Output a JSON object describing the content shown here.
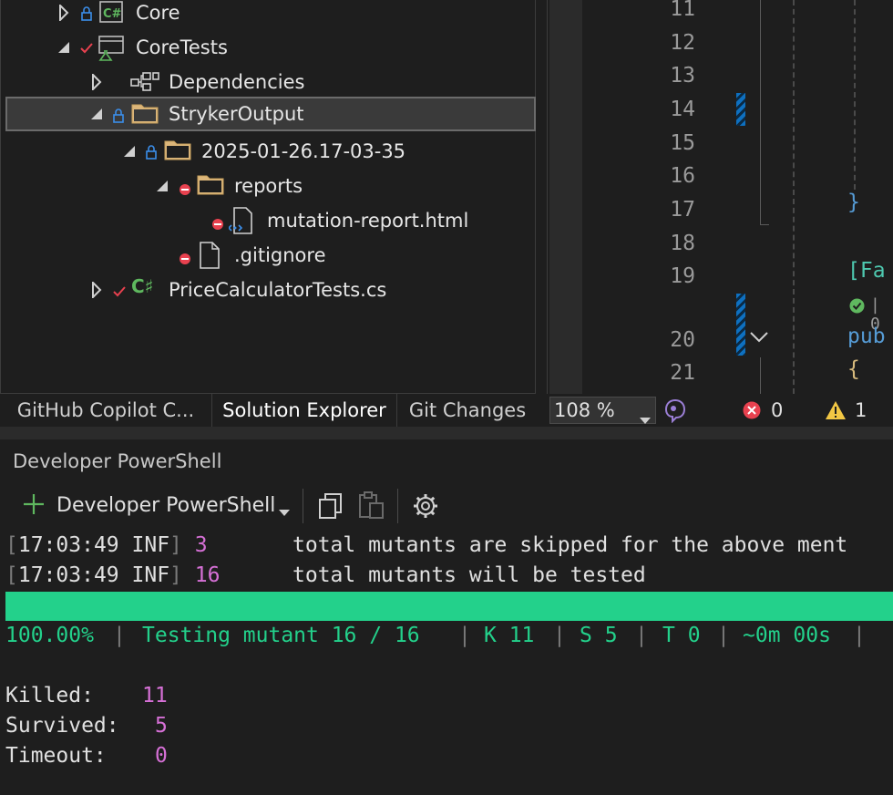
{
  "solution_explorer": {
    "items": [
      {
        "label": "Core",
        "icon": "csharp-project-icon"
      },
      {
        "label": "CoreTests",
        "icon": "test-project-icon"
      },
      {
        "label": "Dependencies",
        "icon": "dependencies-icon"
      },
      {
        "label": "StrykerOutput",
        "icon": "folder-icon"
      },
      {
        "label": "2025-01-26.17-03-35",
        "icon": "folder-icon"
      },
      {
        "label": "reports",
        "icon": "folder-icon"
      },
      {
        "label": "mutation-report.html",
        "icon": "html-file-icon"
      },
      {
        "label": ".gitignore",
        "icon": "file-icon"
      },
      {
        "label": "PriceCalculatorTests.cs",
        "icon": "csharp-file-icon"
      }
    ],
    "tabs": [
      "GitHub Copilot C...",
      "Solution Explorer",
      "Git Changes"
    ]
  },
  "editor": {
    "line_numbers": [
      "11",
      "12",
      "13",
      "14",
      "15",
      "16",
      "17",
      "18",
      "19",
      "20",
      "21"
    ],
    "code": {
      "brace_close": "}",
      "attr": "[Fa",
      "codelens": "| 0",
      "pub": "pub",
      "brace_open": "{"
    },
    "zoom": "108 %",
    "errors": "0",
    "warnings": "1"
  },
  "terminal": {
    "panel_title": "Developer PowerShell",
    "toolbar_label": "Developer PowerShell",
    "log_lines": [
      {
        "time": "17:03:49",
        "level": "INF",
        "count": "3",
        "text": "total mutants are skipped for the above ment"
      },
      {
        "time": "17:03:49",
        "level": "INF",
        "count": "16",
        "text": "total mutants will be tested"
      }
    ],
    "progress": {
      "fraction": 1.0,
      "percent": "100.00%",
      "testing": "Testing mutant 16 / 16",
      "killed": "K 11",
      "survived": "S 5",
      "timeout": "T 0",
      "time": "~0m 00s"
    },
    "summary": [
      {
        "label": "Killed:",
        "value": "11"
      },
      {
        "label": "Survived:",
        "value": "5"
      },
      {
        "label": "Timeout:",
        "value": "0"
      }
    ]
  },
  "colors": {
    "progress_green": "#23d18b",
    "count_magenta": "#d670d6",
    "selection": "#3a3a3a",
    "editor_keyword": "#569cd6",
    "error_red": "#e8414f",
    "warning_yellow": "#f2c744"
  }
}
